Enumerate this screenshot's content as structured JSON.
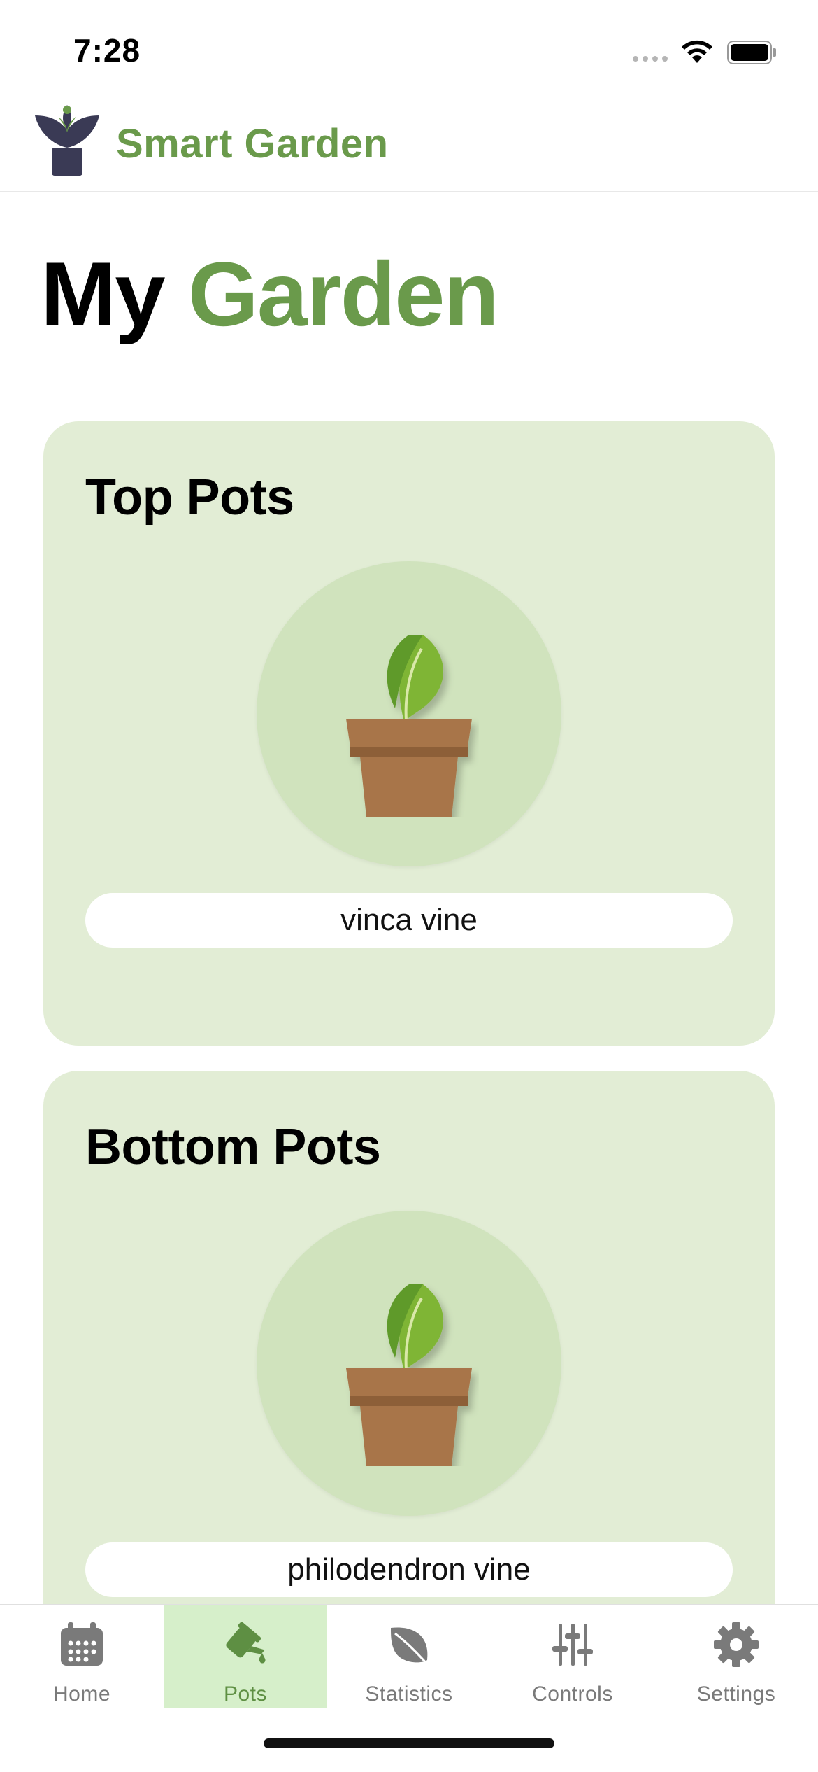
{
  "status_bar": {
    "time": "7:28"
  },
  "header": {
    "app_title": "Smart Garden",
    "logo_icon": "lotus-logo-icon",
    "brand_color": "#6a9a4b"
  },
  "page": {
    "title_part1": "My",
    "title_part2": "Garden"
  },
  "cards": [
    {
      "title": "Top Pots",
      "plant_name": "vinca vine",
      "icon": "potted-plant-icon"
    },
    {
      "title": "Bottom Pots",
      "plant_name": "philodendron vine",
      "icon": "potted-plant-icon"
    }
  ],
  "tabs": [
    {
      "label": "Home",
      "icon": "calendar-icon",
      "active": false
    },
    {
      "label": "Pots",
      "icon": "watering-can-icon",
      "active": true
    },
    {
      "label": "Statistics",
      "icon": "leaf-icon",
      "active": false
    },
    {
      "label": "Controls",
      "icon": "sliders-icon",
      "active": false
    },
    {
      "label": "Settings",
      "icon": "gear-icon",
      "active": false
    }
  ],
  "colors": {
    "card_background": "#e2edd5",
    "active_tab_background": "#d6efca",
    "accent": "#6a9a4b"
  }
}
